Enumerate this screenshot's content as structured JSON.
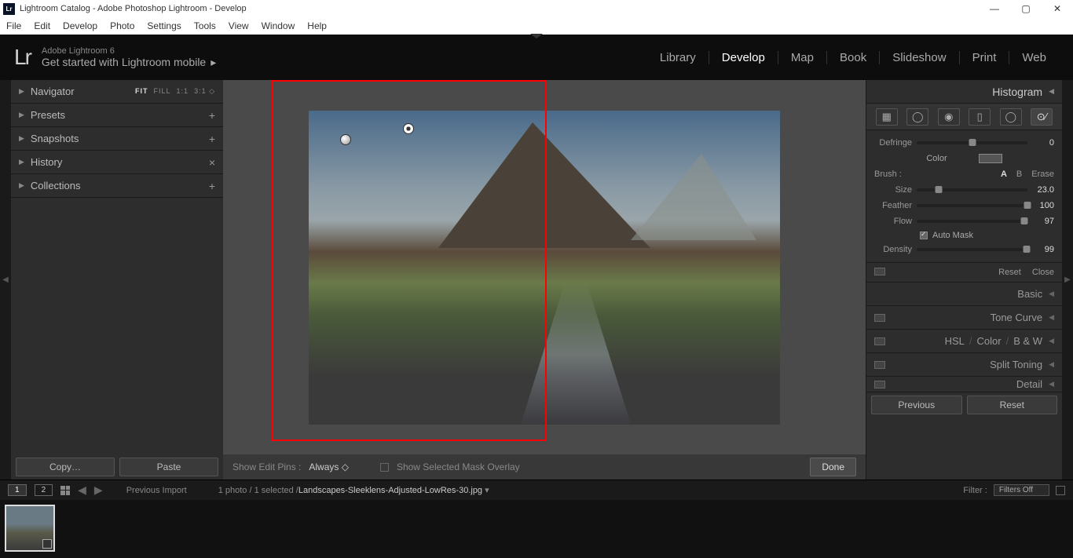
{
  "title": "Lightroom Catalog - Adobe Photoshop Lightroom - Develop",
  "menu": [
    "File",
    "Edit",
    "Develop",
    "Photo",
    "Settings",
    "Tools",
    "View",
    "Window",
    "Help"
  ],
  "id_brand": "Lr",
  "id_ver": "Adobe Lightroom 6",
  "id_link": "Get started with Lightroom mobile",
  "modules": [
    "Library",
    "Develop",
    "Map",
    "Book",
    "Slideshow",
    "Print",
    "Web"
  ],
  "module_active": "Develop",
  "left": {
    "navigator": "Navigator",
    "nav_opts": [
      "FIT",
      "FILL",
      "1:1",
      "3:1"
    ],
    "presets": "Presets",
    "snapshots": "Snapshots",
    "history": "History",
    "collections": "Collections"
  },
  "toolbar": {
    "pins": "Show Edit Pins :",
    "pins_mode": "Always",
    "overlay": "Show Selected Mask Overlay",
    "done": "Done"
  },
  "left_btns": {
    "copy": "Copy…",
    "paste": "Paste"
  },
  "right_btns": {
    "prev": "Previous",
    "reset": "Reset"
  },
  "hist": "Histogram",
  "defringe": {
    "label": "Defringe",
    "val": "0"
  },
  "color": {
    "label": "Color"
  },
  "brush": {
    "title": "Brush :",
    "a": "A",
    "b": "B",
    "erase": "Erase",
    "size": {
      "l": "Size",
      "v": "23.0"
    },
    "feather": {
      "l": "Feather",
      "v": "100"
    },
    "flow": {
      "l": "Flow",
      "v": "97"
    },
    "automask": "Auto Mask",
    "density": {
      "l": "Density",
      "v": "99"
    },
    "reset": "Reset",
    "close": "Close"
  },
  "panels": {
    "basic": "Basic",
    "tone": "Tone Curve",
    "hsl": "HSL",
    "col": "Color",
    "bw": "B & W",
    "split": "Split Toning",
    "detail": "Detail"
  },
  "fs": {
    "prev_import": "Previous Import",
    "count": "1 photo / 1 selected /",
    "file": "Landscapes-Sleeklens-Adjusted-LowRes-30.jpg",
    "filter": "Filter :",
    "filters_off": "Filters Off"
  }
}
